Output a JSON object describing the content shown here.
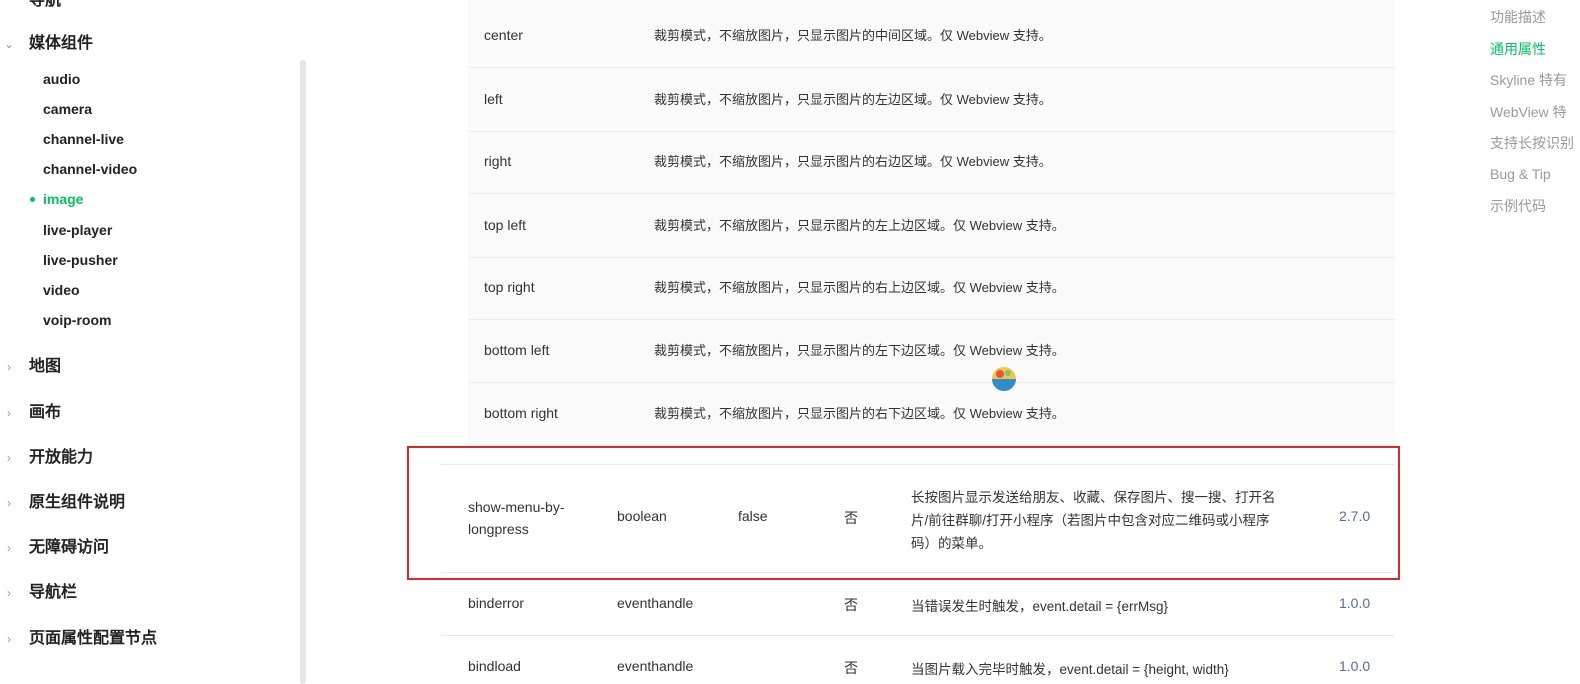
{
  "sidebar": {
    "top_partial": "导航",
    "media_group": "媒体组件",
    "media_items": [
      "audio",
      "camera",
      "channel-live",
      "channel-video",
      "image",
      "live-player",
      "live-pusher",
      "video",
      "voip-room"
    ],
    "active_item": "image",
    "groups_after": [
      "地图",
      "画布",
      "开放能力",
      "原生组件说明",
      "无障碍访问",
      "导航栏",
      "页面属性配置节点"
    ]
  },
  "enum_rows": [
    {
      "value": "center",
      "desc": "裁剪模式，不缩放图片，只显示图片的中间区域。仅 Webview 支持。"
    },
    {
      "value": "left",
      "desc": "裁剪模式，不缩放图片，只显示图片的左边区域。仅 Webview 支持。"
    },
    {
      "value": "right",
      "desc": "裁剪模式，不缩放图片，只显示图片的右边区域。仅 Webview 支持。"
    },
    {
      "value": "top left",
      "desc": "裁剪模式，不缩放图片，只显示图片的左上边区域。仅 Webview 支持。"
    },
    {
      "value": "top right",
      "desc": "裁剪模式，不缩放图片，只显示图片的右上边区域。仅 Webview 支持。"
    },
    {
      "value": "bottom left",
      "desc": "裁剪模式，不缩放图片，只显示图片的左下边区域。仅 Webview 支持。"
    },
    {
      "value": "bottom right",
      "desc": "裁剪模式，不缩放图片，只显示图片的右下边区域。仅 Webview 支持。"
    }
  ],
  "attr_rows": [
    {
      "name_line1": "show-menu-by-",
      "name_line2": "longpress",
      "type": "boolean",
      "default": "false",
      "required": "否",
      "desc_line1": "长按图片显示发送给朋友、收藏、保存图片、搜一搜、打开名",
      "desc_line2": "片/前往群聊/打开小程序（若图片中包含对应二维码或小程序",
      "desc_line3": "码）的菜单。",
      "version": "2.7.0"
    },
    {
      "name": "binderror",
      "type": "eventhandle",
      "default": "",
      "required": "否",
      "desc": "当错误发生时触发，event.detail = {errMsg}",
      "version": "1.0.0"
    },
    {
      "name": "bindload",
      "type": "eventhandle",
      "default": "",
      "required": "否",
      "desc": "当图片载入完毕时触发，event.detail = {height, width}",
      "version": "1.0.0"
    }
  ],
  "toc": {
    "items": [
      "功能描述",
      "通用属性",
      "Skyline 特有",
      "WebView 特",
      "支持长按识别",
      "Bug & Tip",
      "示例代码"
    ],
    "active": "通用属性"
  },
  "colors": {
    "accent": "#07c160",
    "highlight_border": "#e0262a",
    "version_link": "#576b95"
  }
}
